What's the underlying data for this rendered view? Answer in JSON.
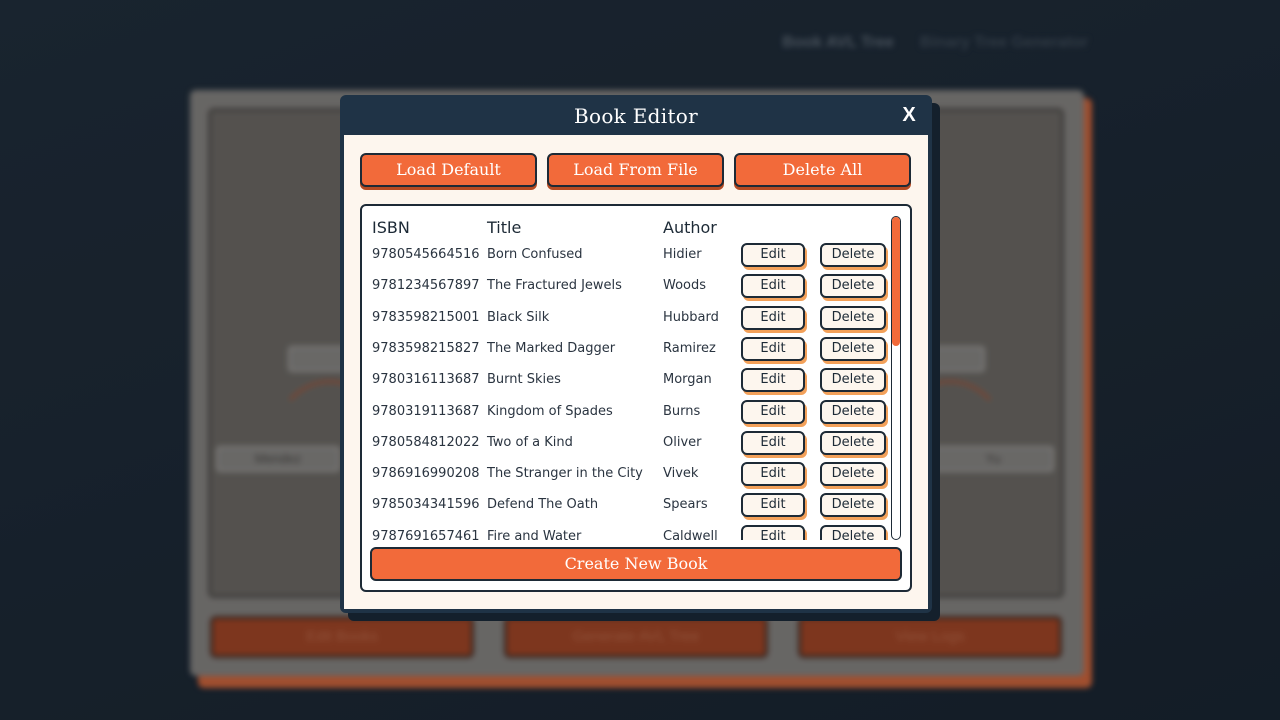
{
  "background": {
    "nav": [
      "Book AVL Tree",
      "Binary Tree Generator"
    ],
    "node_labels": [
      "Mendez",
      "Yu"
    ],
    "bottom_buttons": [
      "Edit Books",
      "Generate AVL Tree",
      "View Logs"
    ]
  },
  "modal": {
    "title": "Book Editor",
    "close_label": "X",
    "buttons": {
      "load_default": "Load Default",
      "load_from_file": "Load From File",
      "delete_all": "Delete All",
      "create_new": "Create New Book"
    },
    "columns": {
      "isbn": "ISBN",
      "title": "Title",
      "author": "Author"
    },
    "edit_label": "Edit",
    "delete_label": "Delete",
    "scroll_position": 0,
    "scroll_visible_fraction": 0.4,
    "books": [
      {
        "isbn": "9780545664516",
        "title": "Born Confused",
        "author": "Hidier"
      },
      {
        "isbn": "9781234567897",
        "title": "The Fractured Jewels",
        "author": "Woods"
      },
      {
        "isbn": "9783598215001",
        "title": "Black Silk",
        "author": "Hubbard"
      },
      {
        "isbn": "9783598215827",
        "title": "The Marked Dagger",
        "author": "Ramirez"
      },
      {
        "isbn": "9780316113687",
        "title": "Burnt Skies",
        "author": "Morgan"
      },
      {
        "isbn": "9780319113687",
        "title": "Kingdom of Spades",
        "author": "Burns"
      },
      {
        "isbn": "9780584812022",
        "title": "Two of a Kind",
        "author": "Oliver"
      },
      {
        "isbn": "9786916990208",
        "title": "The Stranger in the City",
        "author": "Vivek"
      },
      {
        "isbn": "9785034341596",
        "title": "Defend The Oath",
        "author": "Spears"
      },
      {
        "isbn": "9787691657461",
        "title": "Fire and Water",
        "author": "Caldwell"
      }
    ]
  },
  "colors": {
    "accent": "#f26a3a",
    "header": "#1f3346",
    "body": "#fdf6ee",
    "outline": "#1d2a36"
  }
}
